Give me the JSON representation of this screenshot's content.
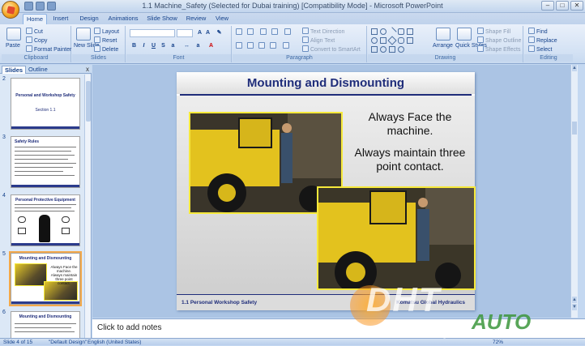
{
  "window": {
    "title": "1.1 Machine_Safety (Selected for Dubai training) [Compatibility Mode] - Microsoft PowerPoint",
    "controls": [
      "–",
      "□",
      "✕"
    ]
  },
  "ribbon_tabs": [
    "Home",
    "Insert",
    "Design",
    "Animations",
    "Slide Show",
    "Review",
    "View"
  ],
  "clipboard": {
    "paste": "Paste",
    "cut": "Cut",
    "copy": "Copy",
    "format_painter": "Format Painter",
    "label": "Clipboard"
  },
  "slides_group": {
    "new_slide": "New Slide",
    "layout": "Layout",
    "reset": "Reset",
    "delete": "Delete",
    "label": "Slides"
  },
  "font_group": {
    "label": "Font"
  },
  "paragraph_group": {
    "text_direction": "Text Direction",
    "align_text": "Align Text",
    "convert": "Convert to SmartArt",
    "label": "Paragraph"
  },
  "drawing_group": {
    "arrange": "Arrange",
    "quick_styles": "Quick Styles",
    "shape_fill": "Shape Fill",
    "shape_outline": "Shape Outline",
    "shape_effects": "Shape Effects",
    "label": "Drawing"
  },
  "editing_group": {
    "find": "Find",
    "replace": "Replace",
    "select": "Select",
    "label": "Editing"
  },
  "pane": {
    "tabs": [
      "Slides",
      "Outline"
    ],
    "close": "x",
    "thumbs": [
      {
        "num": "2",
        "title": "Personal and Workshop Safety",
        "sub": "Section 1.1"
      },
      {
        "num": "3",
        "title": "Safety Rules"
      },
      {
        "num": "4",
        "title": "Personal Protective Equipment"
      },
      {
        "num": "5",
        "title": "Mounting and Dismounting",
        "t1": "Always Face the machine.",
        "t2": "Always maintain three point contact."
      },
      {
        "num": "6",
        "title": "Mounting and Dismounting"
      }
    ]
  },
  "slide": {
    "title": "Mounting and Dismounting",
    "text1": "Always Face the machine.",
    "text2": "Always maintain three point contact.",
    "footer_left": "1.1 Personal Workshop Safety",
    "footer_right": "Komatsu Global Hydraulics"
  },
  "notes": {
    "placeholder": "Click to add notes"
  },
  "status": {
    "slide_of": "Slide 4 of 15",
    "theme": "\"Default Design\"",
    "language": "English (United States)",
    "zoom": "72%"
  },
  "watermark": {
    "main": "DHT",
    "auto": "AUTO",
    "sub": "Sharing creates success"
  }
}
